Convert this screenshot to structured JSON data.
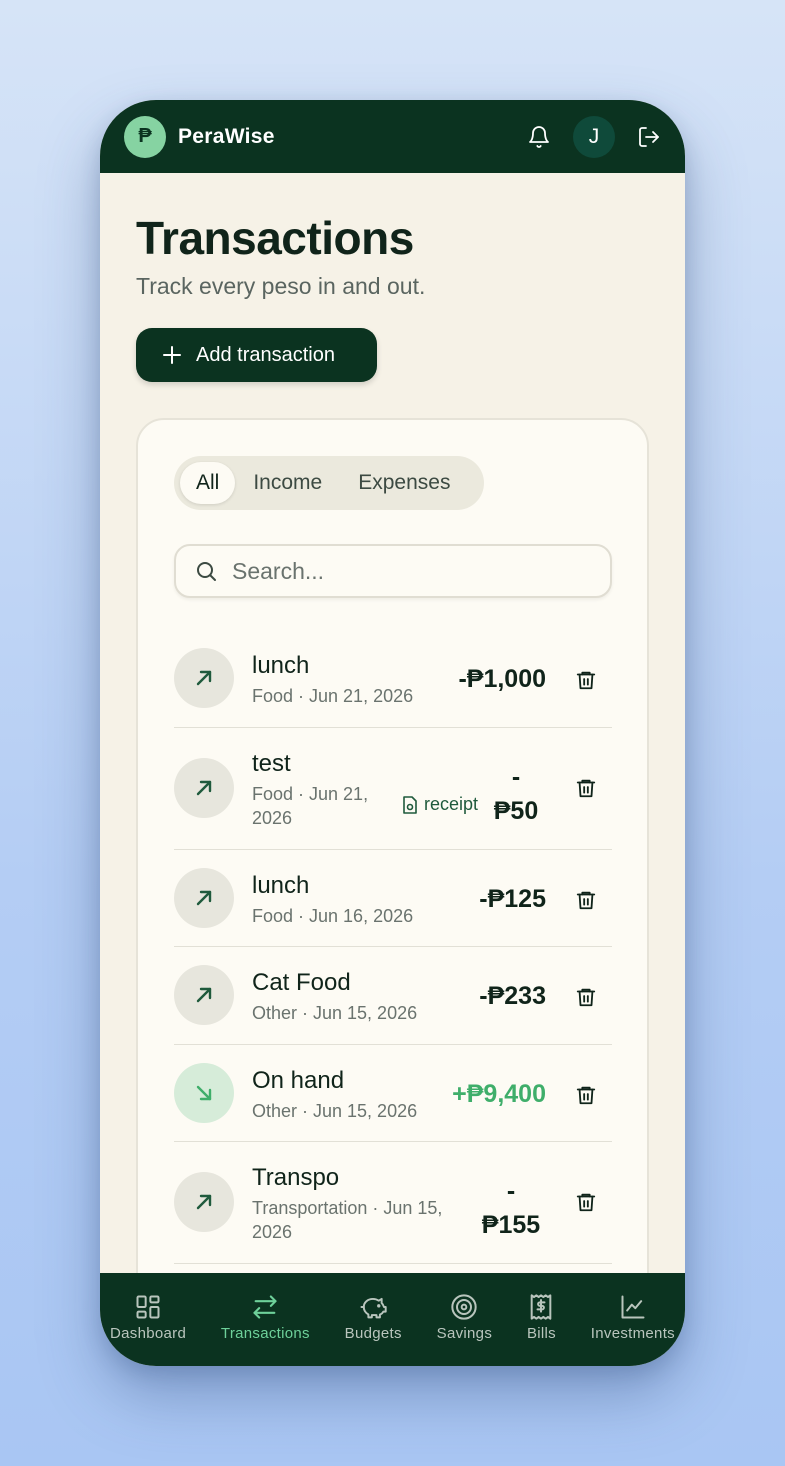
{
  "app": {
    "logo_glyph": "₱",
    "name": "PeraWise",
    "user_initial": "J"
  },
  "header": {
    "icons": [
      "bell-icon",
      "logout-icon"
    ]
  },
  "page": {
    "title": "Transactions",
    "subtitle": "Track every peso in and out.",
    "add_button_label": "Add transaction"
  },
  "filters": {
    "tabs": [
      "All",
      "Income",
      "Expenses"
    ],
    "active": "All"
  },
  "search": {
    "placeholder": "Search..."
  },
  "transactions": [
    {
      "name": "lunch",
      "meta": "Food · Jun 21, 2026",
      "amount": "-₱1,000",
      "type": "expense",
      "receipt": ""
    },
    {
      "name": "test",
      "meta": "Food · Jun 21, 2026",
      "amount": "-₱50",
      "type": "expense",
      "receipt": "receipt"
    },
    {
      "name": "lunch",
      "meta": "Food · Jun 16, 2026",
      "amount": "-₱125",
      "type": "expense",
      "receipt": ""
    },
    {
      "name": "Cat Food",
      "meta": "Other · Jun 15, 2026",
      "amount": "-₱233",
      "type": "expense",
      "receipt": ""
    },
    {
      "name": "On hand",
      "meta": "Other · Jun 15, 2026",
      "amount": "+₱9,400",
      "type": "income",
      "receipt": ""
    },
    {
      "name": "Transpo",
      "meta": "Transportation · Jun 15, 2026",
      "amount": "-₱155",
      "type": "expense",
      "receipt": ""
    }
  ],
  "nav": {
    "items": [
      "Dashboard",
      "Transactions",
      "Budgets",
      "Savings",
      "Bills",
      "Investments"
    ],
    "active": "Transactions"
  },
  "colors": {
    "brand_dark": "#0b3320",
    "accent_green": "#3fae6a",
    "background": "#f6f2e7"
  }
}
